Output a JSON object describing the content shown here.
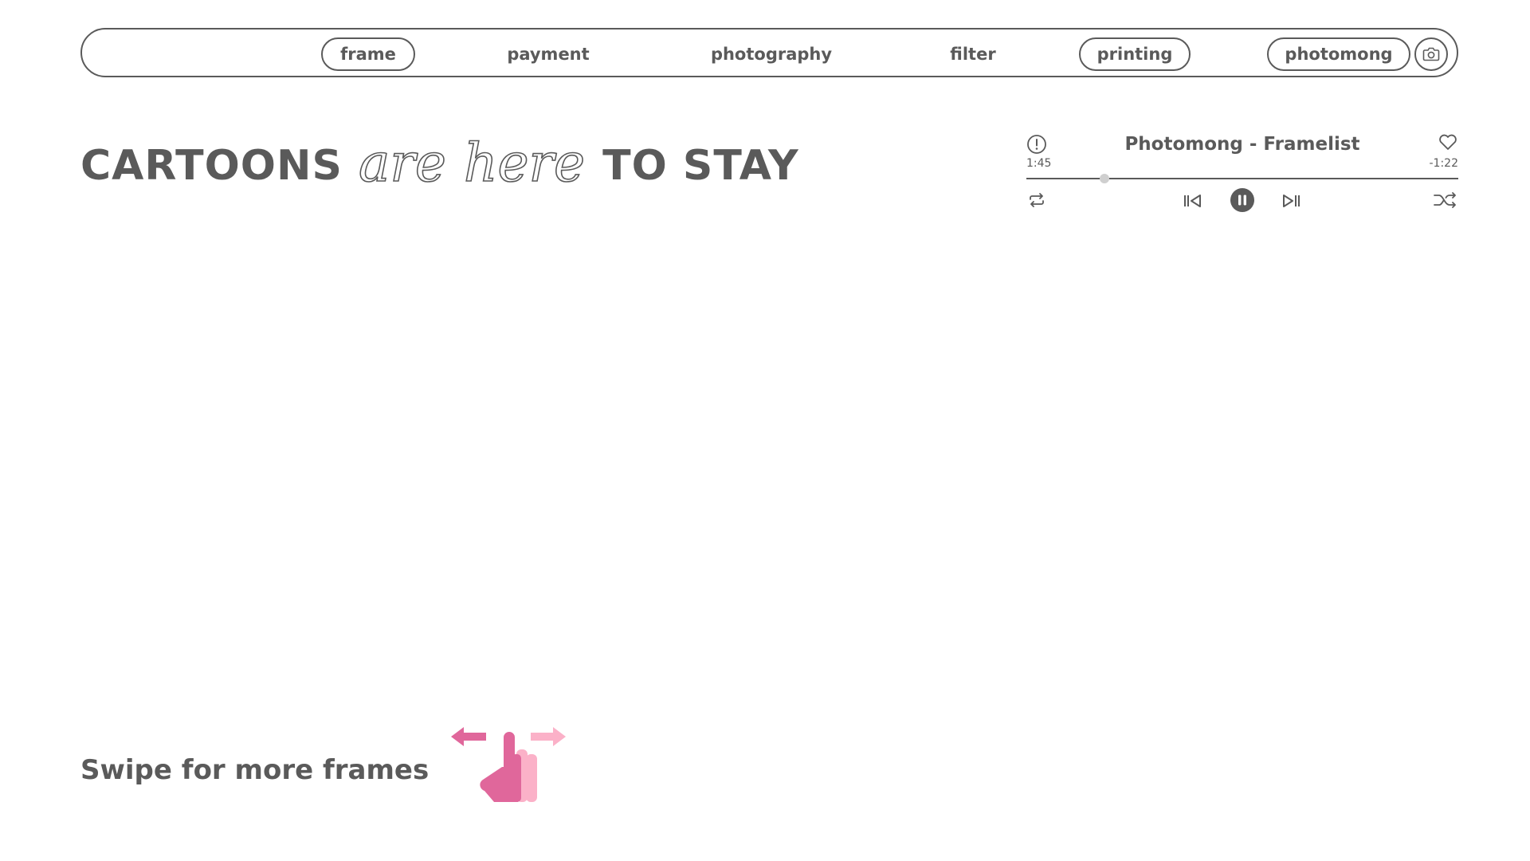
{
  "nav": {
    "items": [
      {
        "label": "frame",
        "outlined": true
      },
      {
        "label": "payment",
        "outlined": false
      },
      {
        "label": "photography",
        "outlined": false
      },
      {
        "label": "filter",
        "outlined": false
      },
      {
        "label": "printing",
        "outlined": true
      },
      {
        "label": "photomong",
        "outlined": true
      }
    ],
    "camera_icon": "camera-icon"
  },
  "headline": {
    "part1": "CARTOONS",
    "script1": "are",
    "script2": "here",
    "part2": "TO STAY"
  },
  "player": {
    "title": "Photomong - Framelist",
    "elapsed": "1:45",
    "remaining": "-1:22",
    "progress": 0.18,
    "icons": {
      "info": "info-icon",
      "like": "heart-icon",
      "repeat": "repeat-icon",
      "previous": "skip-previous-icon",
      "pause": "pause-icon",
      "next": "skip-next-icon",
      "shuffle": "shuffle-icon"
    }
  },
  "swipe": {
    "text": "Swipe for more frames",
    "icon": "swipe-hand-icon"
  },
  "colors": {
    "text": "#5a5a5a",
    "accent_pink": "#e0679b",
    "light_pink": "#fbb1c8",
    "knob": "#cfcfcf"
  }
}
